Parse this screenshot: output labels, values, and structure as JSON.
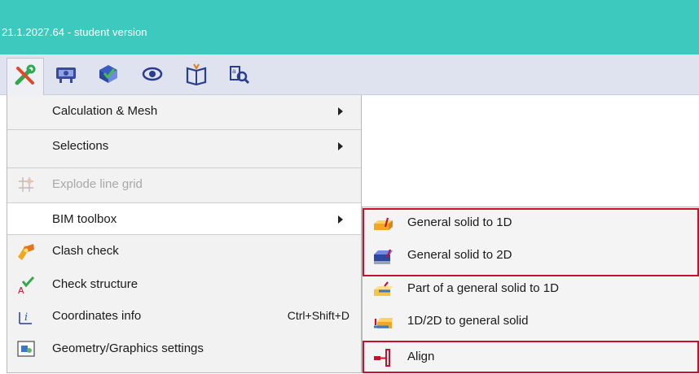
{
  "window": {
    "title": "21.1.2027.64 - student version"
  },
  "toolbar": {
    "buttons": [
      {
        "icon": "tools-icon"
      },
      {
        "icon": "classroom-icon"
      },
      {
        "icon": "check-model-icon"
      },
      {
        "icon": "eye-icon"
      },
      {
        "icon": "open-book-icon"
      },
      {
        "icon": "search-doc-icon"
      }
    ]
  },
  "menu": {
    "items": [
      {
        "label": "Calculation & Mesh",
        "submenu": true
      },
      {
        "label": "Selections",
        "submenu": true
      },
      {
        "label": "Explode line grid",
        "disabled": true,
        "icon": "grid-explode-icon"
      },
      {
        "label": "BIM toolbox",
        "submenu": true,
        "highlighted": true
      },
      {
        "label": "Clash check",
        "icon": "clash-icon"
      },
      {
        "label": "Check structure",
        "icon": "check-structure-icon"
      },
      {
        "label": "Coordinates info",
        "shortcut": "Ctrl+Shift+D",
        "icon": "coordinates-icon"
      },
      {
        "label": "Geometry/Graphics settings",
        "icon": "settings-icon"
      }
    ]
  },
  "submenu": {
    "items": [
      {
        "label": "General solid to 1D",
        "icon": "solid-to-1d-icon"
      },
      {
        "label": "General solid to 2D",
        "icon": "solid-to-2d-icon"
      },
      {
        "label": "Part of a general solid to 1D",
        "icon": "part-solid-to-1d-icon"
      },
      {
        "label": "1D/2D to general solid",
        "icon": "to-general-solid-icon"
      },
      {
        "label": "Align",
        "icon": "align-icon"
      }
    ]
  },
  "colors": {
    "titlebar": "#3dc9bd",
    "toolbar": "#dfe3ef",
    "highlight_box": "#c8102e"
  }
}
